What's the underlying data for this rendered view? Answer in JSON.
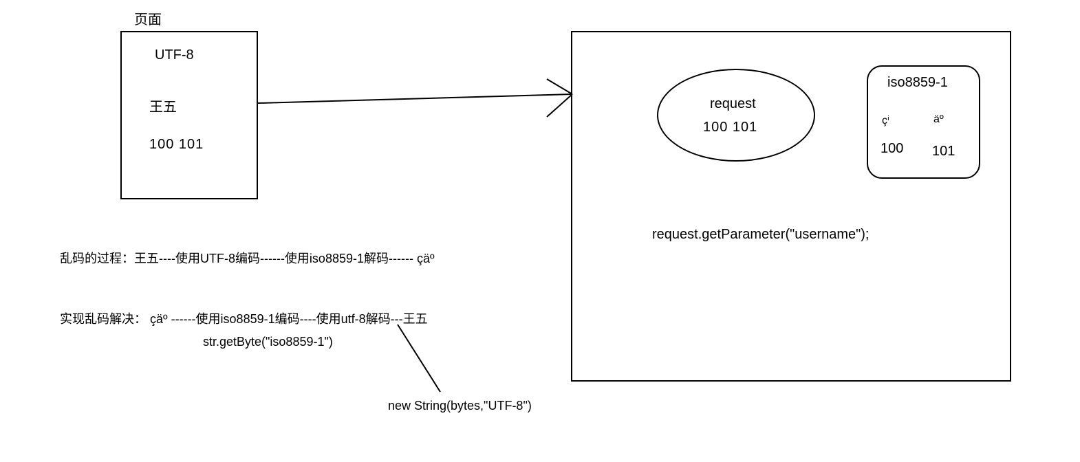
{
  "page_title": "页面",
  "page_box": {
    "encoding": "UTF-8",
    "name": "王五",
    "bytes": "100 101"
  },
  "request_ellipse": {
    "label": "request",
    "bytes": "100 101"
  },
  "iso_box": {
    "encoding": "iso8859-1",
    "char1": "çⁱ",
    "char2": "äº",
    "byte1": "100",
    "byte2": "101"
  },
  "server": {
    "getparam": "request.getParameter(\"username\");"
  },
  "explain": {
    "process": "乱码的过程：王五----使用UTF-8编码------使用iso8859-1解码------ çäº",
    "solve": "实现乱码解决： çäº  ------使用iso8859-1编码----使用utf-8解码---王五",
    "getbyte": "str.getByte(\"iso8859-1\")",
    "newstring": "new String(bytes,\"UTF-8\")"
  }
}
